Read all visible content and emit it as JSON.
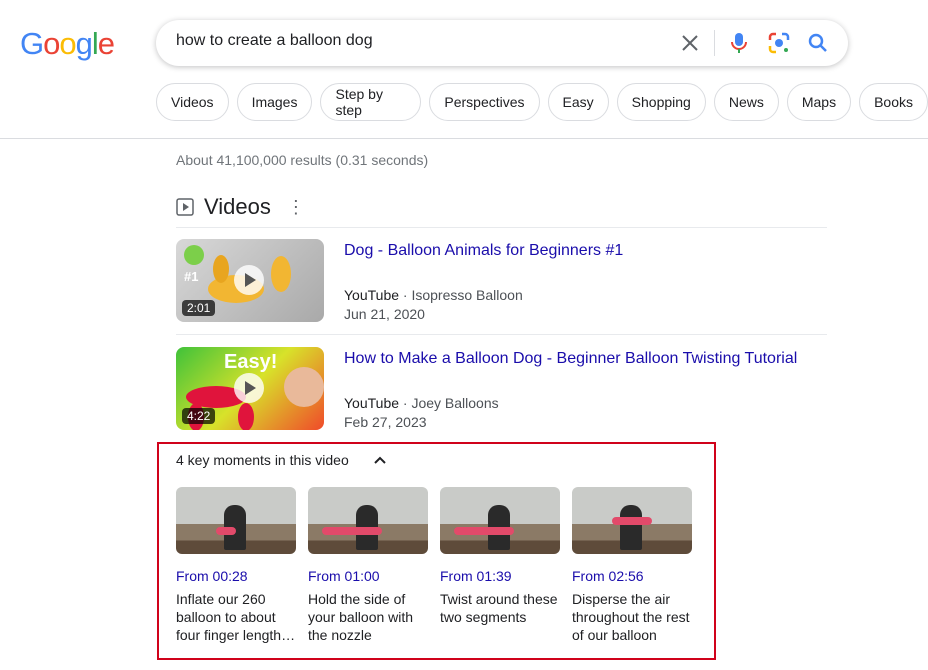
{
  "header": {
    "logo": "Google",
    "query": "how to create a balloon dog",
    "icons": [
      "close-icon",
      "mic-icon",
      "lens-icon",
      "search-icon"
    ]
  },
  "chips": [
    "Videos",
    "Images",
    "Step by step",
    "Perspectives",
    "Easy",
    "Shopping",
    "News",
    "Maps",
    "Books"
  ],
  "stats": "About 41,100,000 results (0.31 seconds)",
  "videos_section": {
    "title": "Videos",
    "items": [
      {
        "title": "Dog - Balloon Animals for Beginners #1",
        "source": "YouTube",
        "channel": "Isopresso Balloon",
        "date": "Jun 21, 2020",
        "duration": "2:01",
        "badge": "#1"
      },
      {
        "title": "How to Make a Balloon Dog - Beginner Balloon Twisting Tutorial",
        "source": "YouTube",
        "channel": "Joey Balloons",
        "date": "Feb 27, 2023",
        "duration": "4:22",
        "overlay": "Easy!"
      }
    ]
  },
  "key_moments": {
    "heading": "4 key moments in this video",
    "items": [
      {
        "from": "From 00:28",
        "desc": "Inflate our 260 balloon to about four finger length…"
      },
      {
        "from": "From 01:00",
        "desc": "Hold the side of your balloon with the nozzle"
      },
      {
        "from": "From 01:39",
        "desc": "Twist around these two segments"
      },
      {
        "from": "From 02:56",
        "desc": "Disperse the air throughout the rest of our balloon"
      }
    ]
  },
  "colors": {
    "link": "#1a0dab",
    "highlight_border": "#d0021b"
  }
}
